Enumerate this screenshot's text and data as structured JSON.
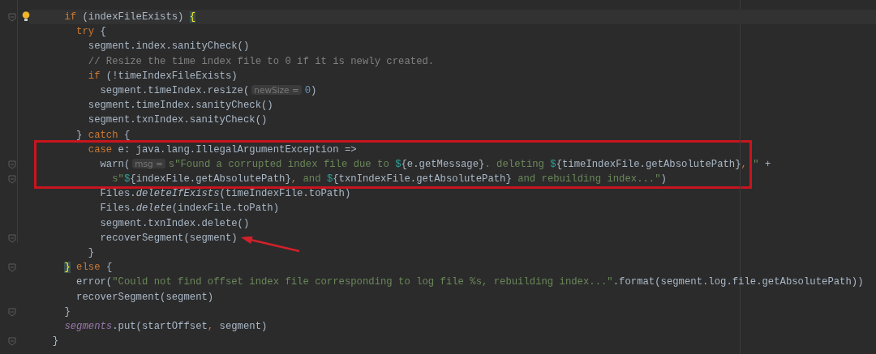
{
  "editor": {
    "lines": [
      {
        "kind": "line",
        "current": true,
        "bulb": true,
        "fold": true,
        "tokens": [
          {
            "kind": "kw",
            "text": "    if"
          },
          {
            "kind": "id",
            "text": " (indexFileExists) "
          },
          {
            "kind": "match",
            "text": "{"
          }
        ]
      },
      {
        "kind": "line",
        "current": false,
        "fold": false,
        "tokens": [
          {
            "kind": "kw",
            "text": "      try"
          },
          {
            "kind": "id",
            "text": " {"
          }
        ]
      },
      {
        "kind": "line",
        "current": false,
        "fold": false,
        "tokens": [
          {
            "kind": "id",
            "text": "        segment.index.sanityCheck()"
          }
        ]
      },
      {
        "kind": "line",
        "current": false,
        "fold": false,
        "tokens": [
          {
            "kind": "cmt",
            "text": "        // Resize the time index file to 0 if it is newly created."
          }
        ]
      },
      {
        "kind": "line",
        "current": false,
        "fold": false,
        "tokens": [
          {
            "kind": "kw",
            "text": "        if"
          },
          {
            "kind": "id",
            "text": " (!timeIndexFileExists)"
          }
        ]
      },
      {
        "kind": "line",
        "current": false,
        "fold": false,
        "tokens": [
          {
            "kind": "id",
            "text": "          segment.timeIndex.resize("
          },
          {
            "kind": "hint",
            "text": "newSize ="
          },
          {
            "kind": "num",
            "text": "0"
          },
          {
            "kind": "id",
            "text": ")"
          }
        ]
      },
      {
        "kind": "line",
        "current": false,
        "fold": false,
        "tokens": [
          {
            "kind": "id",
            "text": "        segment.timeIndex.sanityCheck()"
          }
        ]
      },
      {
        "kind": "line",
        "current": false,
        "fold": false,
        "tokens": [
          {
            "kind": "id",
            "text": "        segment.txnIndex.sanityCheck()"
          }
        ]
      },
      {
        "kind": "line",
        "current": false,
        "fold": false,
        "tokens": [
          {
            "kind": "id",
            "text": "      } "
          },
          {
            "kind": "kw",
            "text": "catch"
          },
          {
            "kind": "id",
            "text": " {"
          }
        ]
      },
      {
        "kind": "box",
        "lines": [
          {
            "kind": "line",
            "current": false,
            "fold": false,
            "tokens": [
              {
                "kind": "kw",
                "text": "        case"
              },
              {
                "kind": "id",
                "text": " e: java.lang.IllegalArgumentException =>"
              }
            ]
          },
          {
            "kind": "line",
            "current": false,
            "fold": true,
            "tokens": [
              {
                "kind": "id",
                "text": "          warn("
              },
              {
                "kind": "hint",
                "text": "msg ="
              },
              {
                "kind": "str",
                "text": "s\"Found a corrupted index file due to "
              },
              {
                "kind": "interp",
                "text": "$"
              },
              {
                "kind": "id",
                "text": "{e.getMessage}"
              },
              {
                "kind": "str",
                "text": ". deleting "
              },
              {
                "kind": "interp",
                "text": "$"
              },
              {
                "kind": "id",
                "text": "{timeIndexFile.getAbsolutePath}"
              },
              {
                "kind": "kw",
                "text": ","
              },
              {
                "kind": "str",
                "text": " \" "
              },
              {
                "kind": "id",
                "text": "+"
              }
            ]
          },
          {
            "kind": "line",
            "current": false,
            "fold": true,
            "tokens": [
              {
                "kind": "str",
                "text": "            s\""
              },
              {
                "kind": "interp",
                "text": "$"
              },
              {
                "kind": "id",
                "text": "{indexFile.getAbsolutePath}"
              },
              {
                "kind": "kw",
                "text": ","
              },
              {
                "kind": "str",
                "text": " and "
              },
              {
                "kind": "interp",
                "text": "$"
              },
              {
                "kind": "id",
                "text": "{txnIndexFile.getAbsolutePath}"
              },
              {
                "kind": "str",
                "text": " and rebuilding index...\""
              },
              {
                "kind": "id",
                "text": ")"
              }
            ]
          }
        ]
      },
      {
        "kind": "line",
        "current": false,
        "fold": false,
        "tokens": [
          {
            "kind": "id",
            "text": "          Files."
          },
          {
            "kind": "ital",
            "text": "deleteIfExists"
          },
          {
            "kind": "id",
            "text": "(timeIndexFile.toPath)"
          }
        ]
      },
      {
        "kind": "line",
        "current": false,
        "fold": false,
        "tokens": [
          {
            "kind": "id",
            "text": "          Files."
          },
          {
            "kind": "ital",
            "text": "delete"
          },
          {
            "kind": "id",
            "text": "(indexFile.toPath)"
          }
        ]
      },
      {
        "kind": "line",
        "current": false,
        "fold": false,
        "tokens": [
          {
            "kind": "id",
            "text": "          segment.txnIndex.delete()"
          }
        ]
      },
      {
        "kind": "line",
        "current": false,
        "fold": true,
        "arrow": true,
        "tokens": [
          {
            "kind": "id",
            "text": "          recoverSegment(segment)"
          }
        ]
      },
      {
        "kind": "line",
        "current": false,
        "fold": false,
        "tokens": [
          {
            "kind": "id",
            "text": "        }"
          }
        ]
      },
      {
        "kind": "line",
        "current": false,
        "fold": true,
        "tokens": [
          {
            "kind": "match",
            "text": "    }"
          },
          {
            "kind": "kw",
            "text": " else"
          },
          {
            "kind": "id",
            "text": " {"
          }
        ]
      },
      {
        "kind": "line",
        "current": false,
        "fold": false,
        "tokens": [
          {
            "kind": "id",
            "text": "      error("
          },
          {
            "kind": "str",
            "text": "\"Could not find offset index file corresponding to log file %s, rebuilding index...\""
          },
          {
            "kind": "id",
            "text": ".format(segment.log.file.getAbsolutePath))"
          }
        ]
      },
      {
        "kind": "line",
        "current": false,
        "fold": false,
        "tokens": [
          {
            "kind": "id",
            "text": "      recoverSegment(segment)"
          }
        ]
      },
      {
        "kind": "line",
        "current": false,
        "fold": true,
        "tokens": [
          {
            "kind": "id",
            "text": "    }"
          }
        ]
      },
      {
        "kind": "line",
        "current": false,
        "fold": false,
        "tokens": [
          {
            "kind": "field",
            "text": "    segments"
          },
          {
            "kind": "id",
            "text": ".put(startOffset"
          },
          {
            "kind": "kw",
            "text": ","
          },
          {
            "kind": "id",
            "text": " segment)"
          }
        ]
      },
      {
        "kind": "line",
        "current": false,
        "fold": true,
        "tokens": [
          {
            "kind": "id",
            "text": "  }"
          }
        ]
      }
    ]
  }
}
